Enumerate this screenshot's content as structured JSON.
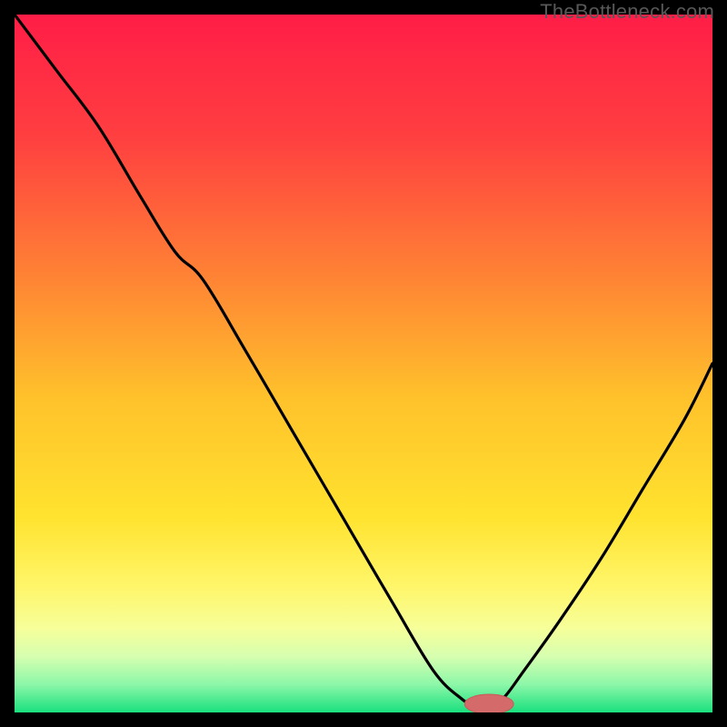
{
  "watermark": "TheBottleneck.com",
  "colors": {
    "frame_bg": "#000000",
    "curve": "#000000",
    "marker_fill": "#d46a6a",
    "marker_stroke": "#c85a5a",
    "gradient_stops": [
      {
        "offset": 0.0,
        "color": "#ff1d47"
      },
      {
        "offset": 0.18,
        "color": "#ff4040"
      },
      {
        "offset": 0.35,
        "color": "#ff7a36"
      },
      {
        "offset": 0.55,
        "color": "#ffc22b"
      },
      {
        "offset": 0.72,
        "color": "#ffe32f"
      },
      {
        "offset": 0.82,
        "color": "#fff66a"
      },
      {
        "offset": 0.88,
        "color": "#f6ff9a"
      },
      {
        "offset": 0.92,
        "color": "#d6ffb0"
      },
      {
        "offset": 0.96,
        "color": "#8cf7a8"
      },
      {
        "offset": 1.0,
        "color": "#19e07e"
      }
    ]
  },
  "chart_data": {
    "type": "line",
    "title": "",
    "xlabel": "",
    "ylabel": "",
    "xlim": [
      0,
      100
    ],
    "ylim": [
      0,
      100
    ],
    "series": [
      {
        "name": "bottleneck-curve",
        "x": [
          0,
          6,
          12,
          18,
          23,
          27,
          33,
          40,
          47,
          54,
          60,
          64,
          66,
          68,
          70,
          73,
          78,
          84,
          90,
          96,
          100
        ],
        "y": [
          100,
          92,
          84,
          74,
          66,
          62,
          52,
          40,
          28,
          16,
          6,
          2,
          1,
          1,
          2,
          6,
          13,
          22,
          32,
          42,
          50
        ]
      }
    ],
    "marker": {
      "x": 68,
      "y": 1.2,
      "rx": 3.5,
      "ry": 1.4
    },
    "note": "Values are read off the image; y is distance from bottom as % of plot height."
  }
}
